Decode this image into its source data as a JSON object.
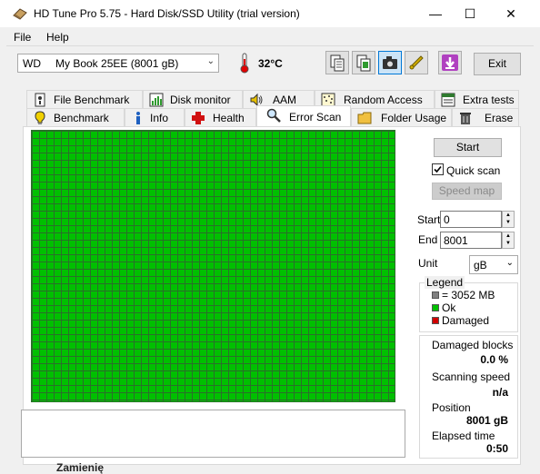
{
  "window": {
    "title": "HD Tune Pro 5.75 - Hard Disk/SSD Utility (trial version)",
    "minimize": "—",
    "maximize": "☐",
    "close": "✕"
  },
  "menu": [
    {
      "label": "File"
    },
    {
      "label": "Help"
    }
  ],
  "toolbar": {
    "drive_prefix": "WD",
    "drive_name": "My Book 25EE (8001 gB)",
    "temperature": "32°C",
    "exit_label": "Exit"
  },
  "tabs_row1": [
    {
      "label": "File Benchmark",
      "icon": "file-benchmark-icon"
    },
    {
      "label": "Disk monitor",
      "icon": "disk-monitor-icon"
    },
    {
      "label": "AAM",
      "icon": "speaker-icon"
    },
    {
      "label": "Random Access",
      "icon": "random-access-icon"
    },
    {
      "label": "Extra tests",
      "icon": "extra-tests-icon"
    }
  ],
  "tabs_row2": [
    {
      "label": "Benchmark",
      "icon": "benchmark-icon"
    },
    {
      "label": "Info",
      "icon": "info-icon"
    },
    {
      "label": "Health",
      "icon": "health-cross-icon"
    },
    {
      "label": "Error Scan",
      "icon": "magnifier-icon",
      "active": true
    },
    {
      "label": "Folder Usage",
      "icon": "folder-icon"
    },
    {
      "label": "Erase",
      "icon": "trash-icon"
    }
  ],
  "scan": {
    "start_button": "Start",
    "quick_scan_label": "Quick scan",
    "quick_scan_checked": true,
    "speed_map_button": "Speed map",
    "start_label": "Start",
    "start_value": "0",
    "end_label": "End",
    "end_value": "8001",
    "unit_label": "Unit",
    "unit_value": "gB"
  },
  "legend": {
    "title": "Legend",
    "items": [
      {
        "label": "= 3052 MB",
        "color": "#808080"
      },
      {
        "label": "Ok",
        "color": "#00c000"
      },
      {
        "label": "Damaged",
        "color": "#d00000"
      }
    ]
  },
  "stats": {
    "damaged_label": "Damaged blocks",
    "damaged_value": "0.0 %",
    "speed_label": "Scanning speed",
    "speed_value": "n/a",
    "position_label": "Position",
    "position_value": "8001 gB",
    "elapsed_label": "Elapsed time",
    "elapsed_value": "0:50"
  },
  "background": {
    "bottom_text": "Zamienię"
  },
  "colors": {
    "ok_green": "#00c000",
    "grid_line": "#2a6f2a",
    "accent": "#0078d7"
  }
}
